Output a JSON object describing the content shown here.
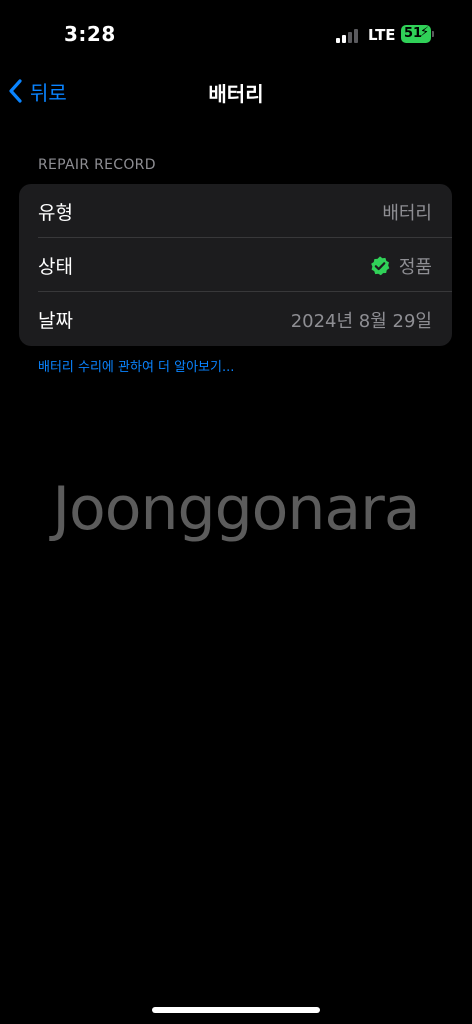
{
  "status_bar": {
    "time": "3:28",
    "network": "LTE",
    "battery_level": "51",
    "battery_color": "#30d158"
  },
  "nav": {
    "back_label": "뒤로",
    "back_icon": "chevron-left-icon",
    "title": "배터리",
    "accent_color": "#0a84ff"
  },
  "repair_record": {
    "header": "REPAIR RECORD",
    "rows": [
      {
        "label": "유형",
        "value": "배터리"
      },
      {
        "label": "상태",
        "value": "정품",
        "icon": "verified-check-icon"
      },
      {
        "label": "날짜",
        "value": "2024년 8월 29일"
      }
    ],
    "learn_more": "배터리 수리에 관하여 더 알아보기..."
  },
  "watermark": {
    "text": "Joonggonara"
  }
}
